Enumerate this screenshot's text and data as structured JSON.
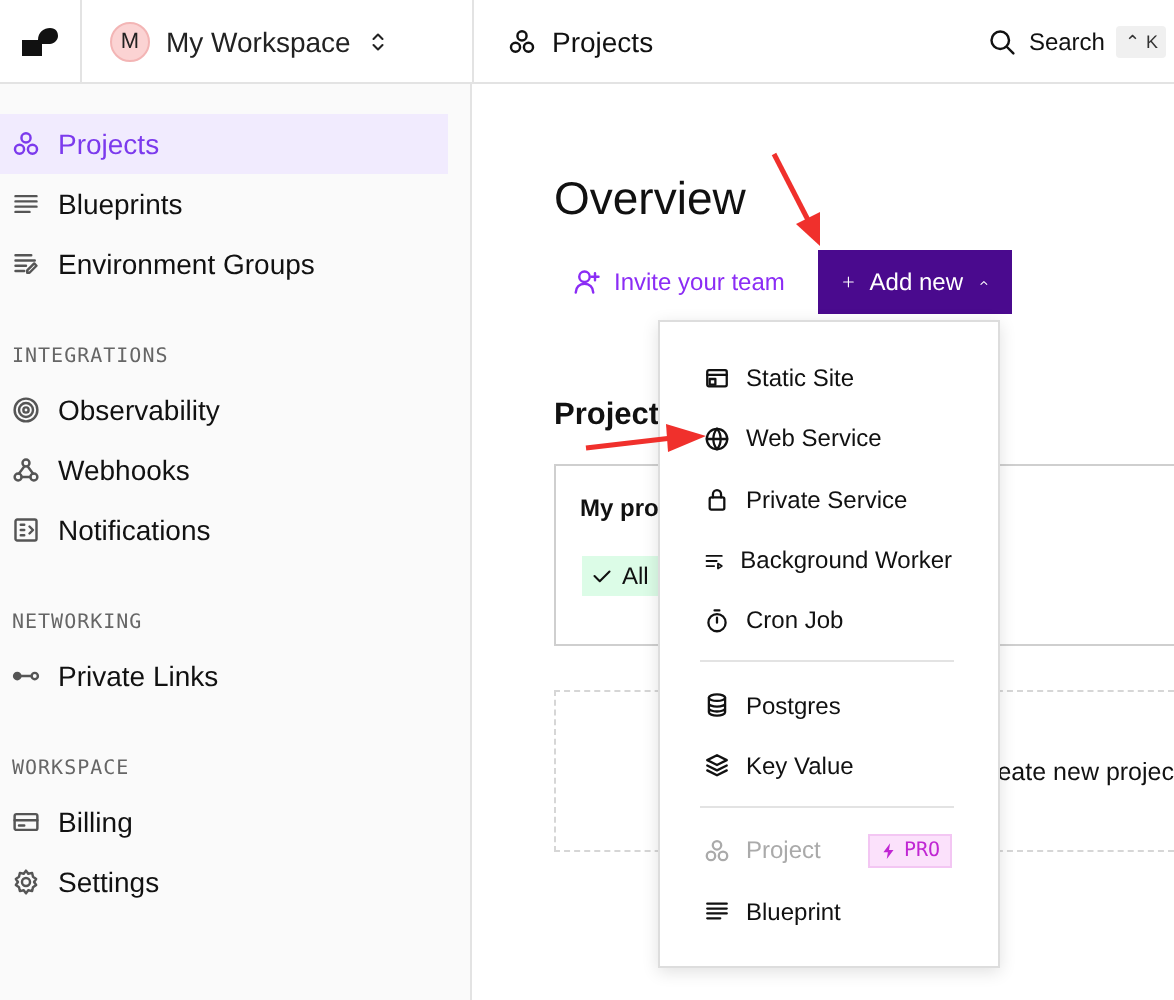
{
  "header": {
    "workspace_initial": "M",
    "workspace_name": "My Workspace",
    "page_title": "Projects",
    "search_label": "Search",
    "shortcut": "⌃ K"
  },
  "sidebar": {
    "groups": [
      {
        "items": [
          {
            "label": "Projects",
            "selected": true
          },
          {
            "label": "Blueprints",
            "selected": false
          },
          {
            "label": "Environment Groups",
            "selected": false
          }
        ]
      },
      {
        "title": "INTEGRATIONS",
        "items": [
          {
            "label": "Observability",
            "selected": false
          },
          {
            "label": "Webhooks",
            "selected": false
          },
          {
            "label": "Notifications",
            "selected": false
          }
        ]
      },
      {
        "title": "NETWORKING",
        "items": [
          {
            "label": "Private Links",
            "selected": false
          }
        ]
      },
      {
        "title": "WORKSPACE",
        "items": [
          {
            "label": "Billing",
            "selected": false
          },
          {
            "label": "Settings",
            "selected": false
          }
        ]
      }
    ]
  },
  "main": {
    "heading": "Overview",
    "invite_link": "Invite your team",
    "add_button": {
      "label": "Add new",
      "expanded": true
    },
    "section_heading": "Project",
    "project_card": {
      "name": "My pro",
      "tag": "All"
    },
    "create_card": {
      "text": "eate new projec"
    }
  },
  "menu": {
    "groups": [
      [
        {
          "label": "Static Site",
          "disabled": false
        },
        {
          "label": "Web Service",
          "disabled": false
        },
        {
          "label": "Private Service",
          "disabled": false
        },
        {
          "label": "Background Worker",
          "disabled": false
        },
        {
          "label": "Cron Job",
          "disabled": false
        }
      ],
      [
        {
          "label": "Postgres",
          "disabled": false
        },
        {
          "label": "Key Value",
          "disabled": false
        }
      ],
      [
        {
          "label": "Project",
          "disabled": true,
          "badge": "PRO"
        },
        {
          "label": "Blueprint",
          "disabled": false
        }
      ]
    ]
  }
}
